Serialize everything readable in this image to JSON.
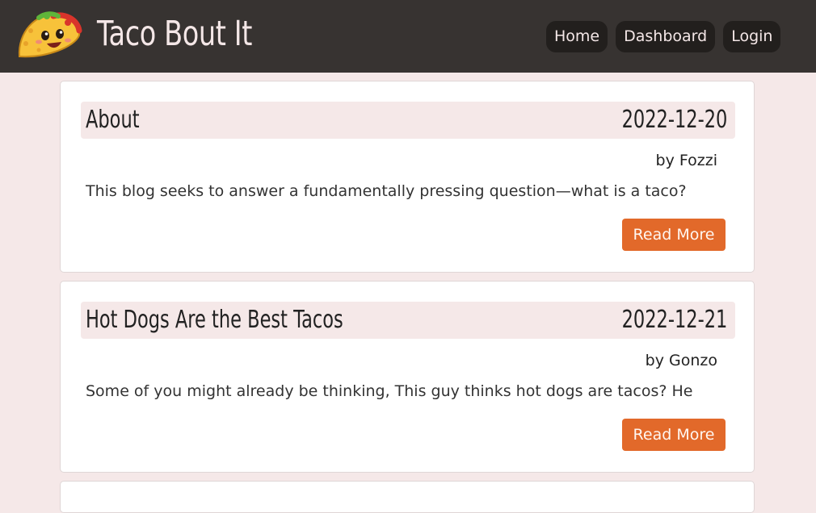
{
  "header": {
    "site_title": "Taco Bout It",
    "logo_icon": "taco-mascot-icon",
    "nav": [
      {
        "label": "Home"
      },
      {
        "label": "Dashboard"
      },
      {
        "label": "Login"
      }
    ]
  },
  "colors": {
    "header_bg": "#373331",
    "page_bg": "#f5e8e8",
    "accent": "#e2692a",
    "nav_button_bg": "#221f1d"
  },
  "posts": [
    {
      "title": "About",
      "date": "2022-12-20",
      "author": "by Fozzi",
      "excerpt": "This blog seeks to answer a fundamentally pressing question—what is a taco?",
      "read_more": "Read More"
    },
    {
      "title": "Hot Dogs Are the Best Tacos",
      "date": "2022-12-21",
      "author": "by Gonzo",
      "excerpt": "Some of you might already be thinking, This guy thinks hot dogs are tacos? He",
      "read_more": "Read More"
    }
  ]
}
